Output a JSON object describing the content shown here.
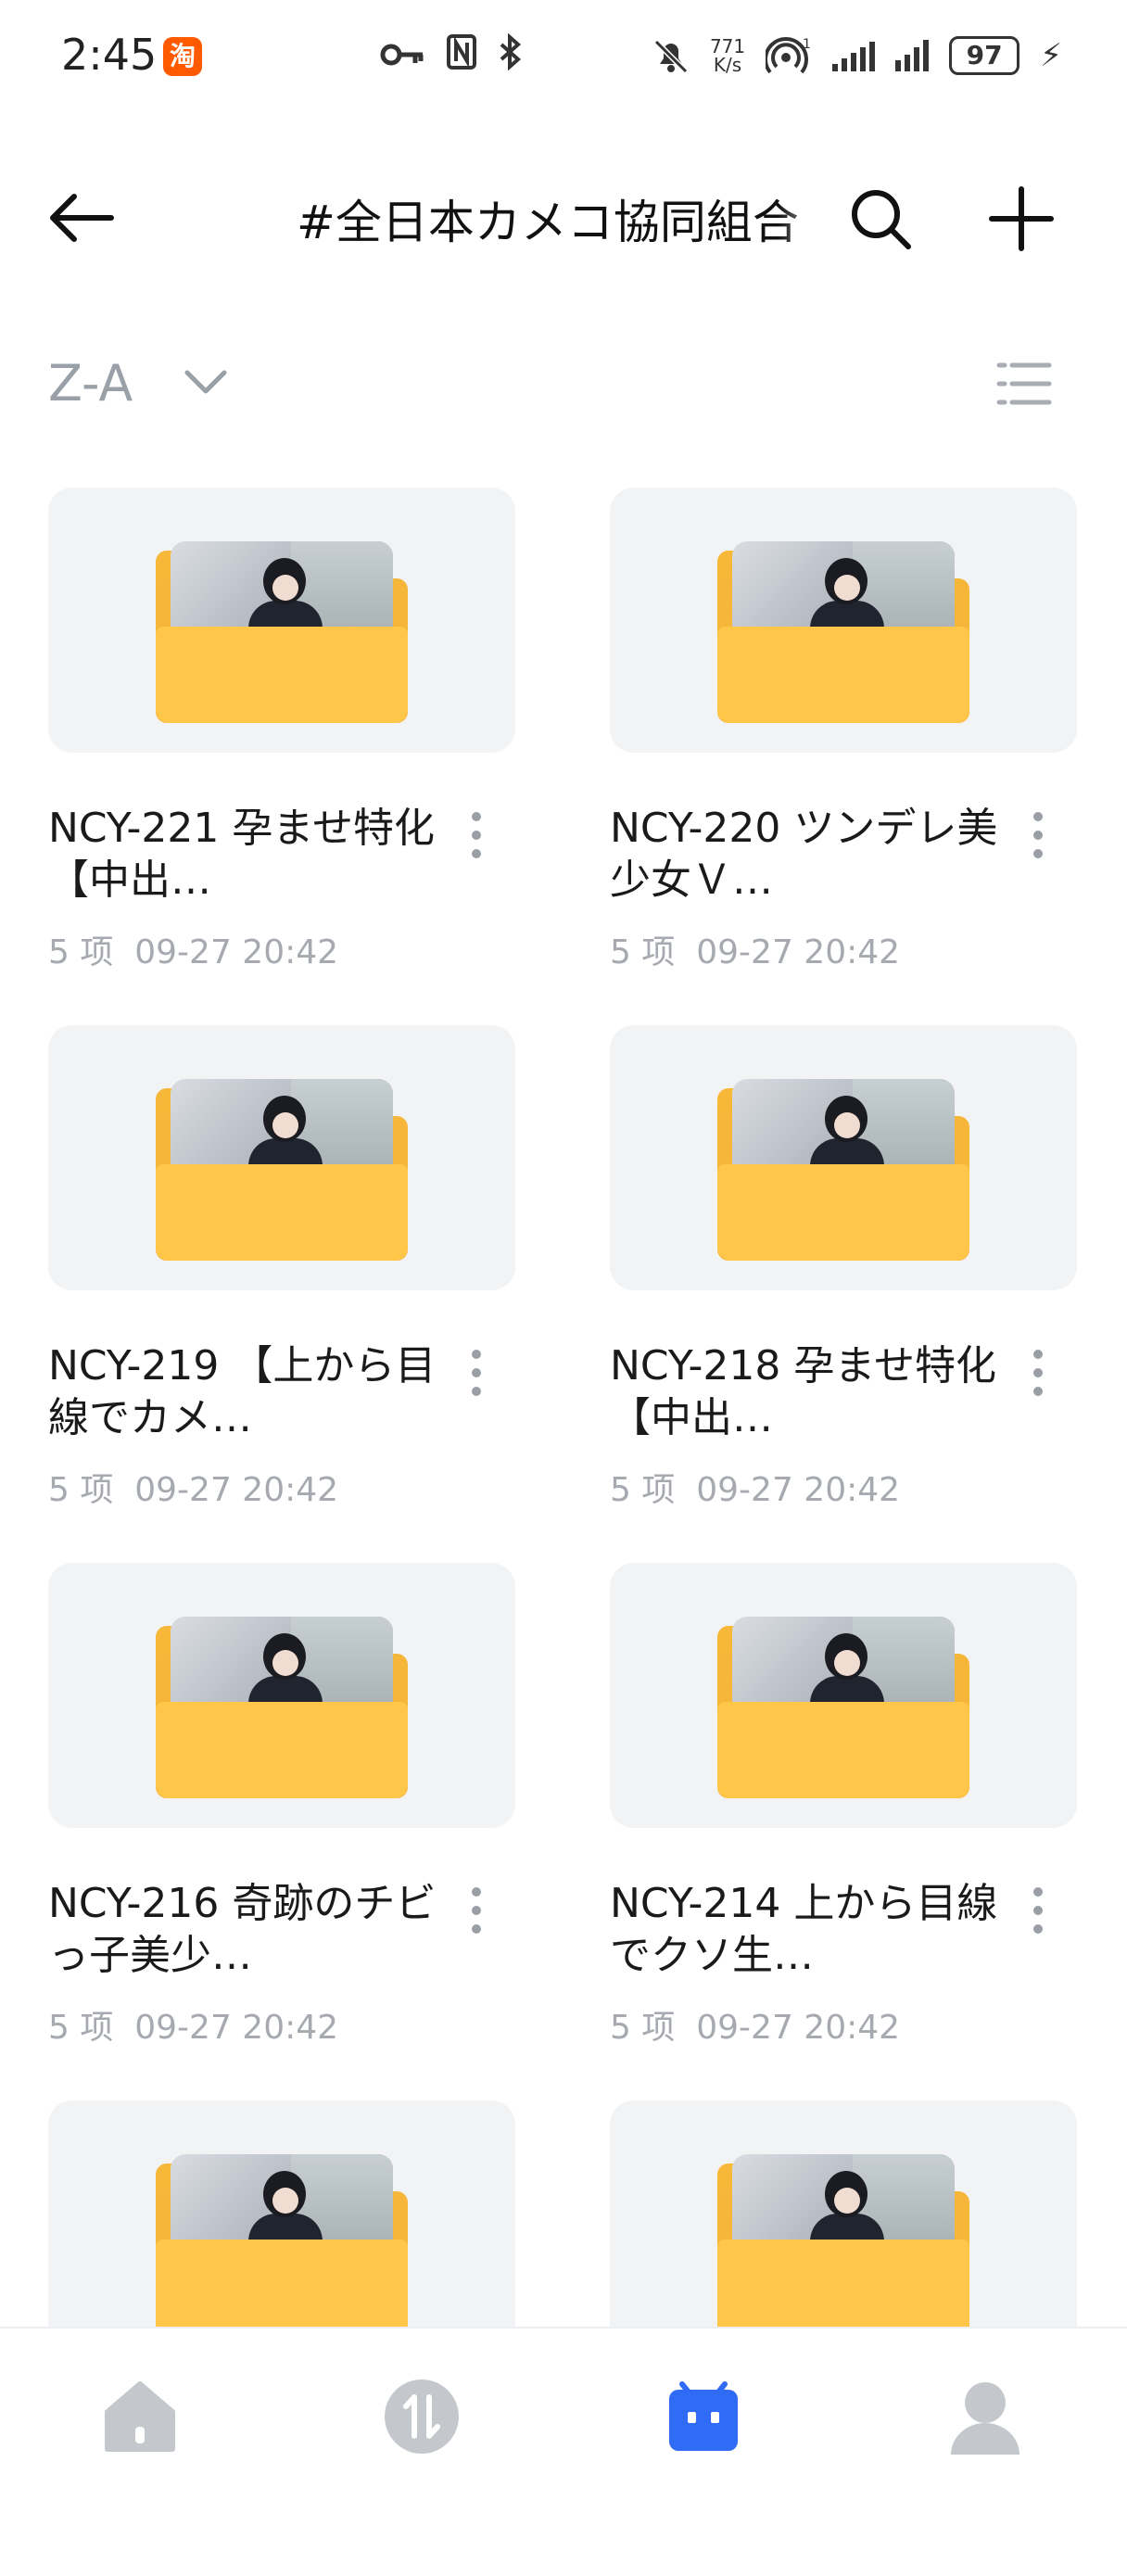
{
  "status_bar": {
    "time": "2:45",
    "taobao_badge": "淘",
    "net_speed_value": "771",
    "net_speed_unit": "K/s",
    "hotspot_count": "1",
    "battery": "97"
  },
  "header": {
    "title": "#全日本カメコ協同組合",
    "back_icon": "arrow-left-icon",
    "search_icon": "search-icon",
    "add_icon": "plus-icon"
  },
  "sort": {
    "label": "Z-A",
    "view_icon": "list-view-icon"
  },
  "folders": [
    {
      "name": "NCY-221 孕ませ特化【中出…",
      "count": "5 项",
      "date": "09-27 20:42"
    },
    {
      "name": "NCY-220 ツンデレ美少女Ｖ…",
      "count": "5 项",
      "date": "09-27 20:42"
    },
    {
      "name": "NCY-219 【上から目線でカメ…",
      "count": "5 项",
      "date": "09-27 20:42"
    },
    {
      "name": "NCY-218 孕ませ特化【中出…",
      "count": "5 项",
      "date": "09-27 20:42"
    },
    {
      "name": "NCY-216 奇跡のチビっ子美少…",
      "count": "5 项",
      "date": "09-27 20:42"
    },
    {
      "name": "NCY-214 上から目線でクソ生…",
      "count": "5 项",
      "date": "09-27 20:42"
    },
    {
      "name": "",
      "count": "",
      "date": ""
    },
    {
      "name": "",
      "count": "",
      "date": ""
    }
  ],
  "bottom_nav": [
    {
      "icon": "home-icon",
      "active": false
    },
    {
      "icon": "transfer-icon",
      "active": false
    },
    {
      "icon": "files-icon",
      "active": true
    },
    {
      "icon": "profile-icon",
      "active": false
    }
  ],
  "colors": {
    "folder": "#ffc64a",
    "active_nav": "#2f6bf5",
    "inactive_nav": "#c4c7cc",
    "muted_text": "#a6aab0"
  }
}
